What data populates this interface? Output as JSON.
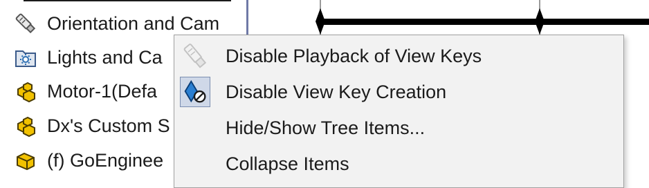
{
  "tree": {
    "items": [
      {
        "label": "Orientation and Cam",
        "icon": "camera-icon"
      },
      {
        "label": "Lights and Ca",
        "icon": "lights-folder-icon"
      },
      {
        "label": "Motor-1(Defa",
        "icon": "assembly-icon"
      },
      {
        "label": "Dx's Custom S",
        "icon": "assembly-icon"
      },
      {
        "label": "(f) GoEnginee",
        "icon": "part-icon"
      }
    ]
  },
  "context_menu": {
    "items": [
      {
        "label": "Disable Playback of View Keys",
        "icon": "camera-playback-icon",
        "disabled_icon": true
      },
      {
        "label": "Disable View Key Creation",
        "icon": "view-key-disable-icon",
        "checked": true
      },
      {
        "label": "Hide/Show Tree Items...",
        "icon": ""
      },
      {
        "label": "Collapse Items",
        "icon": ""
      }
    ]
  },
  "colors": {
    "menu_background": "#f2f2f2",
    "timeline_bar": "#000000",
    "divider": "#6f79a6",
    "assembly_icon": "#e8b400"
  }
}
